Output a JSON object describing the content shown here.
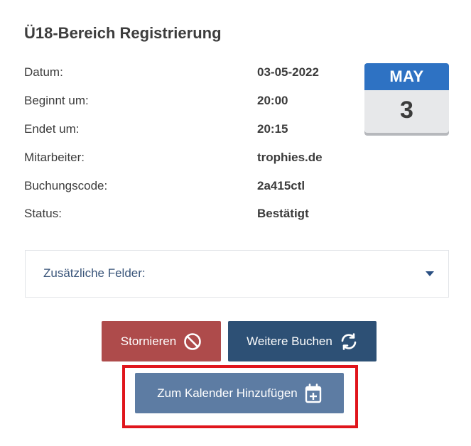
{
  "title": "Ü18-Bereich Registrierung",
  "details": [
    {
      "label": "Datum:",
      "value": "03-05-2022"
    },
    {
      "label": "Beginnt um:",
      "value": "20:00"
    },
    {
      "label": "Endet um:",
      "value": "20:15"
    },
    {
      "label": "Mitarbeiter:",
      "value": "trophies.de"
    },
    {
      "label": "Buchungscode:",
      "value": "2a415ctl"
    },
    {
      "label": "Status:",
      "value": "Bestätigt"
    }
  ],
  "calendar": {
    "month": "MAY",
    "day": "3"
  },
  "extra_fields": {
    "label": "Zusätzliche Felder:",
    "icon": "caret-down-icon"
  },
  "buttons": {
    "cancel": {
      "label": "Stornieren",
      "icon": "ban-icon",
      "color": "#ae4b4b"
    },
    "rebook": {
      "label": "Weitere Buchen",
      "icon": "refresh-icon",
      "color": "#2d5075"
    },
    "add_calendar": {
      "label": "Zum Kalender Hinzufügen",
      "icon": "calendar-plus-icon",
      "color": "#5d7ca3"
    }
  },
  "highlight_color": "#e0151c",
  "accent_color": "#2e72c3"
}
